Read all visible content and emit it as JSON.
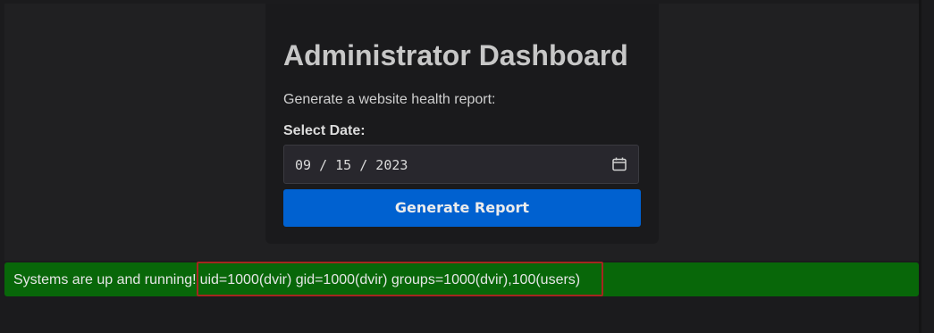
{
  "dashboard": {
    "title": "Administrator Dashboard",
    "subtitle": "Generate a website health report:",
    "date_label": "Select Date:",
    "date_value": "09 / 15 / 2023",
    "generate_button_label": "Generate Report"
  },
  "status": {
    "message": "Systems are up and running!",
    "command_output": "uid=1000(dvir) gid=1000(dvir) groups=1000(dvir),100(users)"
  },
  "colors": {
    "background": "#1b1b1d",
    "card": "#1a1a1c",
    "button": "#0061d0",
    "status_banner": "#086709",
    "highlight_border": "#a5261f"
  },
  "icons": {
    "date_picker": "calendar-icon"
  }
}
